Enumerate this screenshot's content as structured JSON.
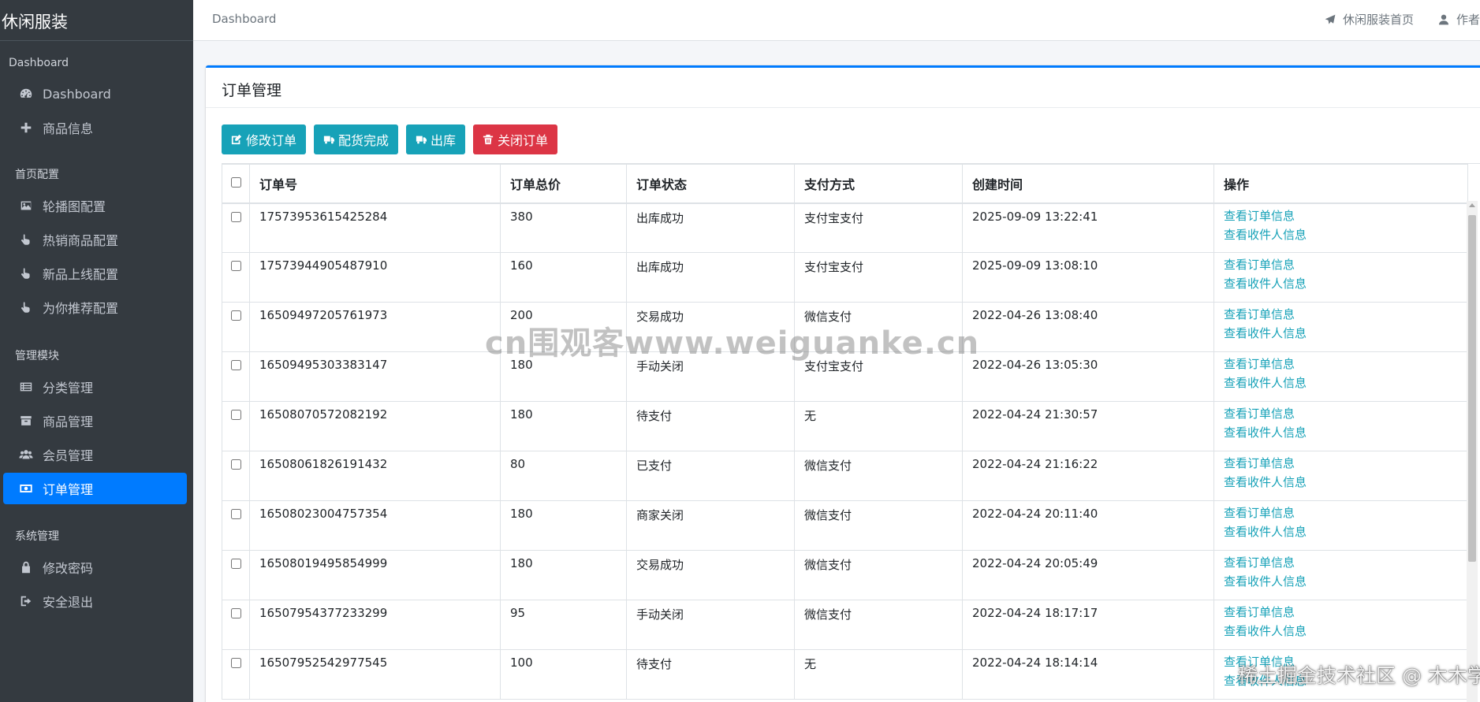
{
  "brand": "休闲服装",
  "sidebar": {
    "headers": [
      "Dashboard",
      "首页配置",
      "管理模块",
      "系统管理"
    ],
    "items": [
      {
        "label": "Dashboard",
        "icon": "tachometer-icon"
      },
      {
        "label": "商品信息",
        "icon": "plus-icon"
      },
      {
        "label": "轮播图配置",
        "icon": "image-icon"
      },
      {
        "label": "热销商品配置",
        "icon": "hand-pointer-icon"
      },
      {
        "label": "新品上线配置",
        "icon": "hand-pointer-icon"
      },
      {
        "label": "为你推荐配置",
        "icon": "hand-pointer-icon"
      },
      {
        "label": "分类管理",
        "icon": "list-icon"
      },
      {
        "label": "商品管理",
        "icon": "box-icon"
      },
      {
        "label": "会员管理",
        "icon": "users-icon"
      },
      {
        "label": "订单管理",
        "icon": "money-icon"
      },
      {
        "label": "修改密码",
        "icon": "lock-icon"
      },
      {
        "label": "安全退出",
        "icon": "sign-out-icon"
      }
    ],
    "active_color": "#007bff"
  },
  "topbar": {
    "breadcrumb": "Dashboard",
    "home_link": "休闲服装首页",
    "author_link": "作者"
  },
  "card": {
    "title": "订单管理",
    "accent": "#007bff"
  },
  "buttons": {
    "edit": "修改订单",
    "picking_done": "配货完成",
    "ship": "出库",
    "close": "关闭订单"
  },
  "table": {
    "headers": [
      "订单号",
      "订单总价",
      "订单状态",
      "支付方式",
      "创建时间",
      "操作"
    ],
    "action_view_order": "查看订单信息",
    "action_view_receiver": "查看收件人信息",
    "rows": [
      {
        "no": "17573953615425284",
        "total": "380",
        "status": "出库成功",
        "pay": "支付宝支付",
        "time": "2025-09-09 13:22:41"
      },
      {
        "no": "17573944905487910",
        "total": "160",
        "status": "出库成功",
        "pay": "支付宝支付",
        "time": "2025-09-09 13:08:10"
      },
      {
        "no": "16509497205761973",
        "total": "200",
        "status": "交易成功",
        "pay": "微信支付",
        "time": "2022-04-26 13:08:40"
      },
      {
        "no": "16509495303383147",
        "total": "180",
        "status": "手动关闭",
        "pay": "支付宝支付",
        "time": "2022-04-26 13:05:30"
      },
      {
        "no": "16508070572082192",
        "total": "180",
        "status": "待支付",
        "pay": "无",
        "time": "2022-04-24 21:30:57"
      },
      {
        "no": "16508061826191432",
        "total": "80",
        "status": "已支付",
        "pay": "微信支付",
        "time": "2022-04-24 21:16:22"
      },
      {
        "no": "16508023004757354",
        "total": "180",
        "status": "商家关闭",
        "pay": "微信支付",
        "time": "2022-04-24 20:11:40"
      },
      {
        "no": "16508019495854999",
        "total": "180",
        "status": "交易成功",
        "pay": "微信支付",
        "time": "2022-04-24 20:05:49"
      },
      {
        "no": "16507954377233299",
        "total": "95",
        "status": "手动关闭",
        "pay": "微信支付",
        "time": "2022-04-24 18:17:17"
      },
      {
        "no": "16507952542977545",
        "total": "100",
        "status": "待支付",
        "pay": "无",
        "time": "2022-04-24 18:14:14"
      }
    ]
  },
  "watermarks": {
    "center": "cn围观客www.weiguanke.cn",
    "corner": "稀土掘金技术社区 @ 木木学长"
  }
}
